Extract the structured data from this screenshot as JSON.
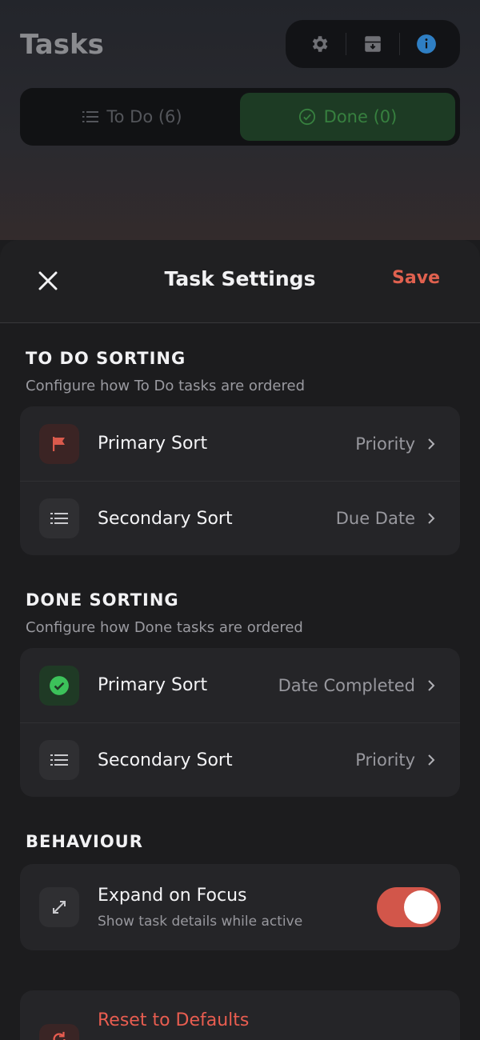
{
  "background_app": {
    "title": "Tasks",
    "toolbar": [
      {
        "icon": "gear-icon"
      },
      {
        "icon": "archive-icon"
      },
      {
        "icon": "info-icon"
      }
    ],
    "segments": [
      {
        "label": "To Do (6)",
        "icon": "list-icon",
        "active": false
      },
      {
        "label": "Done (0)",
        "icon": "check-circle-icon",
        "active": true
      }
    ]
  },
  "sheet": {
    "title": "Task Settings",
    "save_label": "Save",
    "close_icon": "close-icon"
  },
  "todo_sorting": {
    "title": "TO DO SORTING",
    "subtitle": "Configure how To Do tasks are ordered",
    "rows": [
      {
        "label": "Primary Sort",
        "value": "Priority",
        "icon": "flag-icon"
      },
      {
        "label": "Secondary Sort",
        "value": "Due Date",
        "icon": "list-icon"
      }
    ]
  },
  "done_sorting": {
    "title": "DONE SORTING",
    "subtitle": "Configure how Done tasks are ordered",
    "rows": [
      {
        "label": "Primary Sort",
        "value": "Date Completed",
        "icon": "check-circle-icon"
      },
      {
        "label": "Secondary Sort",
        "value": "Priority",
        "icon": "list-icon"
      }
    ]
  },
  "behaviour": {
    "title": "BEHAVIOUR",
    "expand_on_focus": {
      "title": "Expand on Focus",
      "subtitle": "Show task details while active",
      "enabled": true,
      "icon": "expand-icon"
    }
  },
  "reset": {
    "label": "Reset to Defaults",
    "icon": "reset-icon"
  },
  "colors": {
    "accent": "#e0614f",
    "toggle_on": "#d2564a",
    "success": "#37803f",
    "info": "#2f7fc4"
  }
}
